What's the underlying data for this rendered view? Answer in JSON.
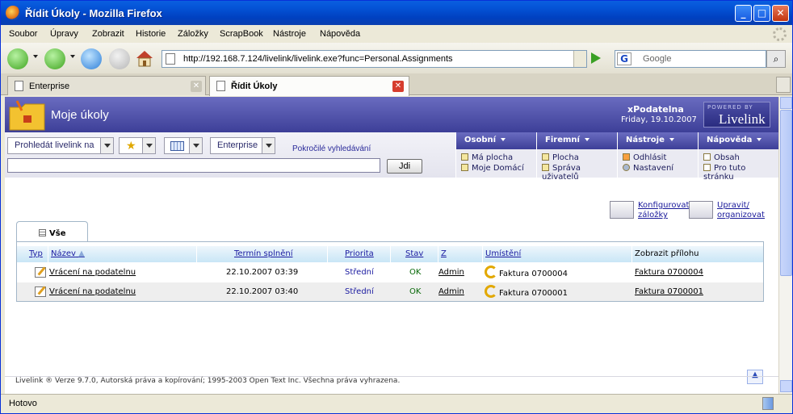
{
  "window": {
    "title": "Řídit Úkoly - Mozilla Firefox"
  },
  "menu": [
    "Soubor",
    "Úpravy",
    "Zobrazit",
    "Historie",
    "Záložky",
    "ScrapBook",
    "Nástroje",
    "Nápověda"
  ],
  "address": {
    "url": "http://192.168.7.124/livelink/livelink.exe?func=Personal.Assignments"
  },
  "search_engine": {
    "placeholder": "Google"
  },
  "tabs": [
    {
      "label": "Enterprise"
    },
    {
      "label": "Řídit Úkoly"
    }
  ],
  "header": {
    "title": "Moje úkoly",
    "user": "xPodatelna",
    "date": "Friday, 19.10.2007",
    "logo_top": "POWERED BY",
    "logo_main": "Livelink"
  },
  "search": {
    "scope_select": "Prohledát livelink na",
    "location_select": "Enterprise",
    "advanced": "Pokročilé vyhledávání",
    "button": "Jdi"
  },
  "menus": [
    {
      "title": "Osobní",
      "items": [
        "Má plocha",
        "Moje Domácí"
      ]
    },
    {
      "title": "Firemní",
      "items": [
        "Plocha",
        "Správa uživatelů"
      ]
    },
    {
      "title": "Nástroje",
      "items": [
        "Odhlásit",
        "Nastavení"
      ]
    },
    {
      "title": "Nápověda",
      "items": [
        "Obsah",
        "Pro tuto stránku"
      ]
    }
  ],
  "actions": {
    "configure": [
      "Konfigurovat",
      "záložky"
    ],
    "edit": [
      "Upravit/",
      "organizovat"
    ]
  },
  "view_tab": "Vše",
  "table": {
    "columns": [
      "Typ",
      "Název",
      "Termín splnění",
      "Priorita",
      "Stav",
      "Z",
      "Umístění",
      "Zobrazit přílohu"
    ],
    "rows": [
      {
        "name": "Vrácení na podatelnu",
        "due": "22.10.2007 03:39",
        "priority": "Střední",
        "status": "OK",
        "from": "Admin",
        "location": "Faktura 0700004",
        "attachment": "Faktura 0700004"
      },
      {
        "name": "Vrácení na podatelnu",
        "due": "22.10.2007 03:40",
        "priority": "Střední",
        "status": "OK",
        "from": "Admin",
        "location": "Faktura 0700001",
        "attachment": "Faktura 0700001"
      }
    ]
  },
  "footer": "Livelink ® Verze 9.7.0, Autorská práva a kopírování; 1995-2003 Open Text Inc. Všechna práva vyhrazena.",
  "statusbar": "Hotovo",
  "colors": {
    "header": "#3d3f98",
    "titlebar": "#0453d6",
    "table_head": "#c9e6f6"
  }
}
